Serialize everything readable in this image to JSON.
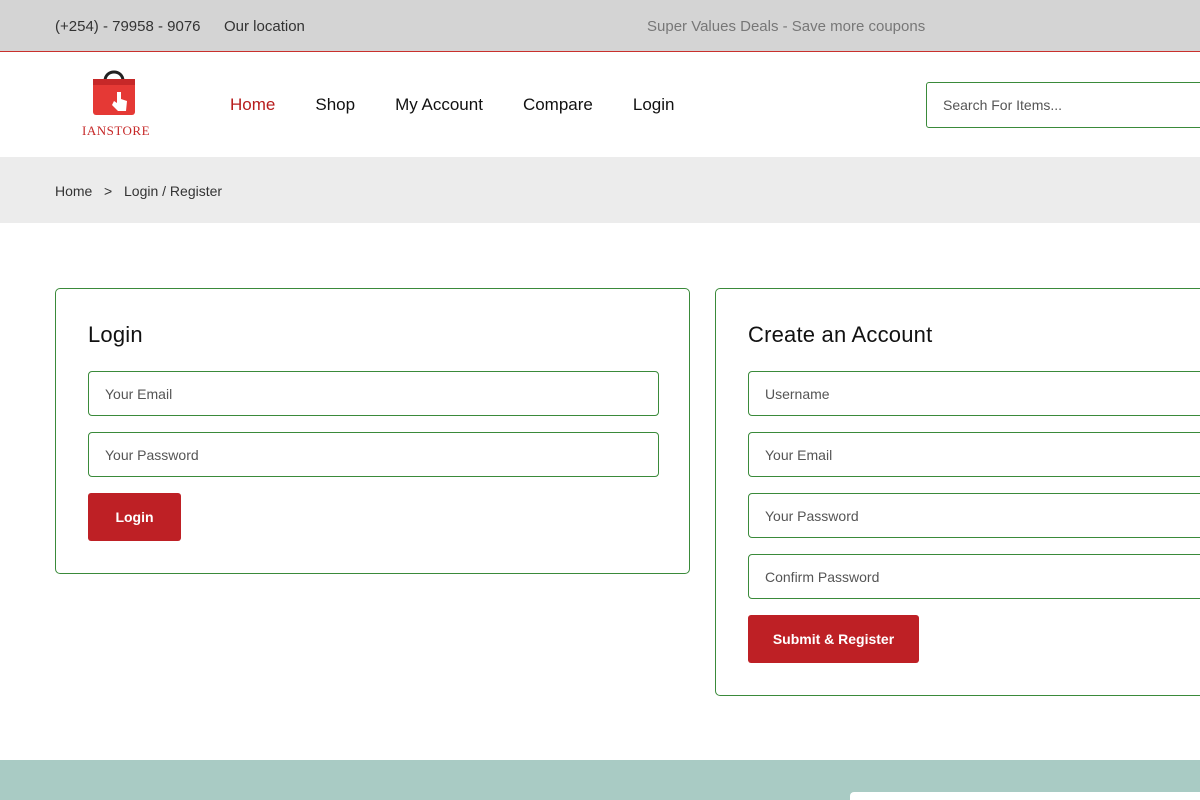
{
  "topbar": {
    "phone": "(+254) - 79958 - 9076",
    "location": "Our location",
    "deals": "Super Values Deals - Save more coupons"
  },
  "brand": {
    "name": "IANSTORE",
    "accent": "#be2025",
    "border_green": "#3a8a3a"
  },
  "nav": {
    "home": "Home",
    "shop": "Shop",
    "my_account": "My Account",
    "compare": "Compare",
    "login": "Login"
  },
  "search": {
    "placeholder": "Search For Items..."
  },
  "breadcrumb": {
    "home": "Home",
    "separator": ">",
    "current": "Login / Register"
  },
  "login": {
    "title": "Login",
    "email_placeholder": "Your Email",
    "password_placeholder": "Your Password",
    "button": "Login"
  },
  "register": {
    "title": "Create an Account",
    "username_placeholder": "Username",
    "email_placeholder": "Your Email",
    "password_placeholder": "Your Password",
    "confirm_placeholder": "Confirm Password",
    "button": "Submit & Register"
  }
}
